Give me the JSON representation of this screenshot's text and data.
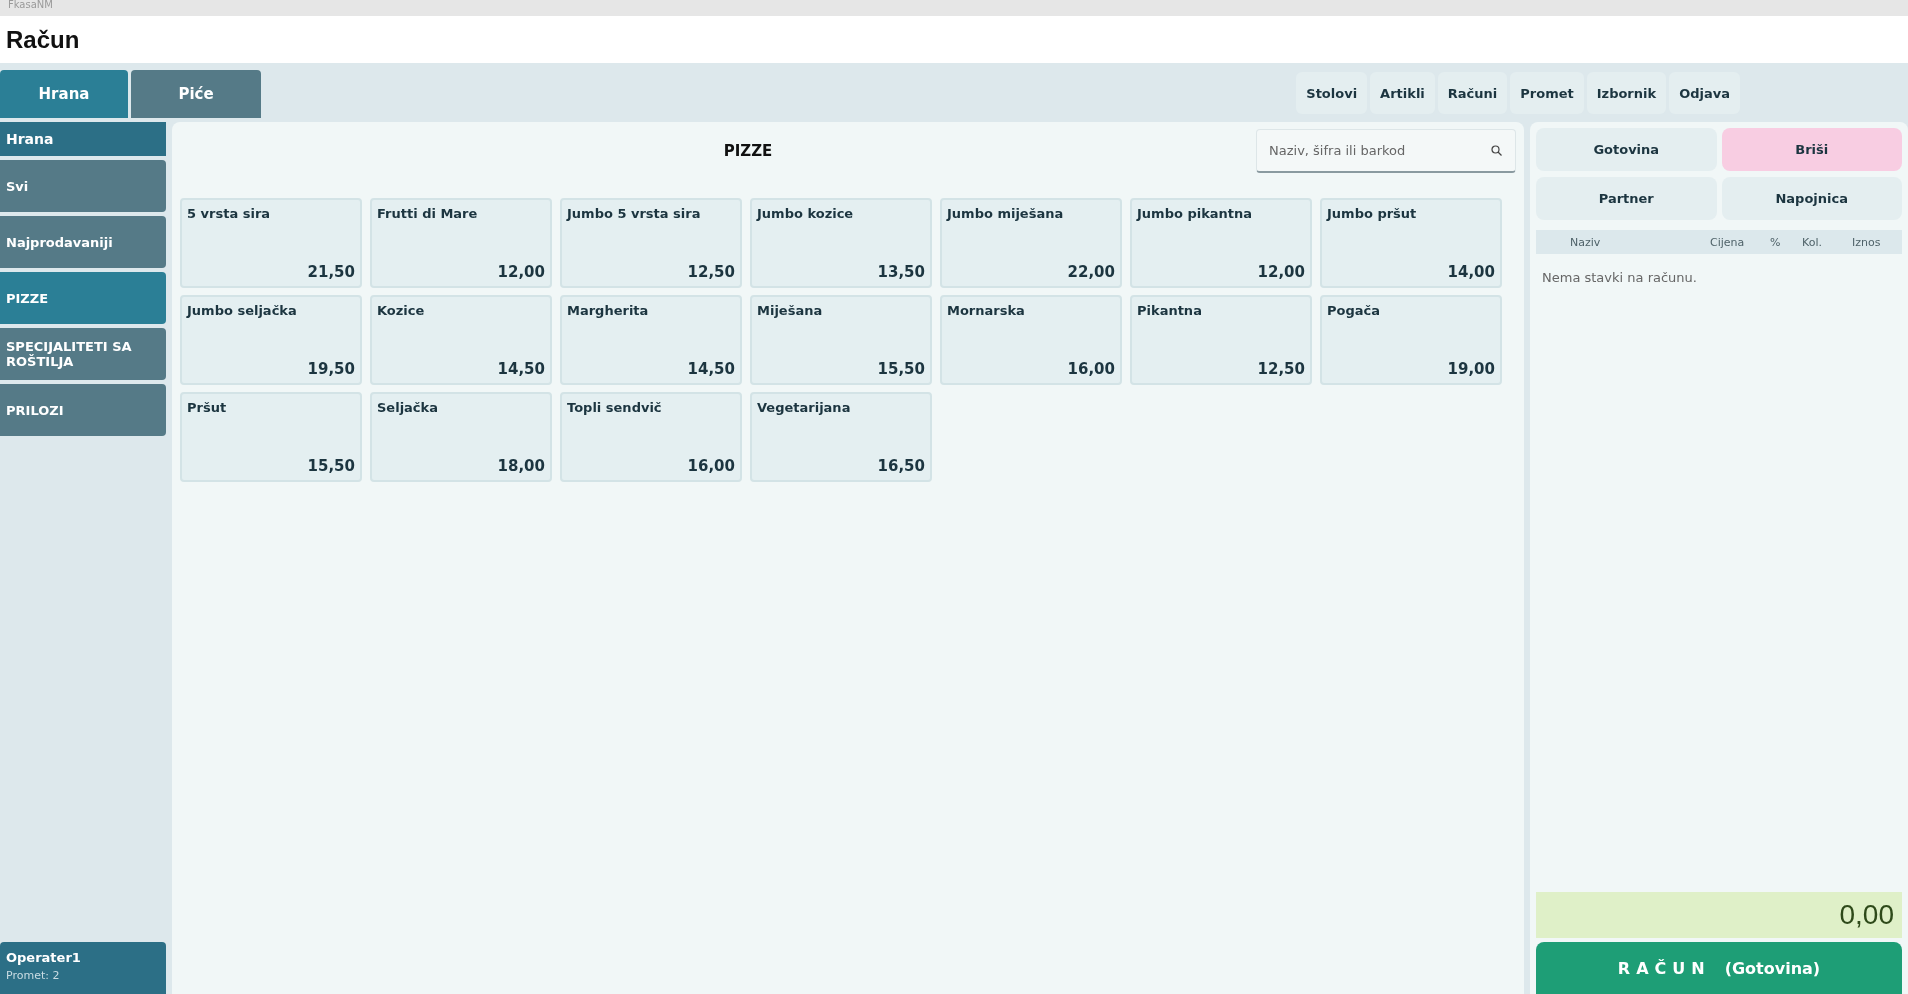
{
  "window": {
    "title": "FkasaNM"
  },
  "header": {
    "title": "Račun"
  },
  "group_tabs": [
    {
      "label": "Hrana",
      "selected": true
    },
    {
      "label": "Piće",
      "selected": false
    }
  ],
  "nav_buttons": [
    "Stolovi",
    "Artikli",
    "Računi",
    "Promet",
    "Izbornik",
    "Odjava"
  ],
  "sidebar": {
    "heading": "Hrana",
    "items": [
      {
        "label": "Svi",
        "selected": false
      },
      {
        "label": "Najprodavaniji",
        "selected": false
      },
      {
        "label": "PIZZE",
        "selected": true
      },
      {
        "label": "SPECIJALITETI SA ROŠTILJA",
        "selected": false
      },
      {
        "label": "PRILOZI",
        "selected": false
      }
    ],
    "operator": {
      "name": "Operater1",
      "info": "Promet: 2"
    }
  },
  "products": {
    "title": "PIZZE",
    "search": {
      "placeholder": "Naziv, šifra ili barkod"
    },
    "items": [
      {
        "name": "5 vrsta sira",
        "price": "21,50"
      },
      {
        "name": "Frutti di Mare",
        "price": "12,00"
      },
      {
        "name": "Jumbo 5 vrsta sira",
        "price": "12,50"
      },
      {
        "name": "Jumbo kozice",
        "price": "13,50"
      },
      {
        "name": "Jumbo miješana",
        "price": "22,00"
      },
      {
        "name": "Jumbo pikantna",
        "price": "12,00"
      },
      {
        "name": "Jumbo pršut",
        "price": "14,00"
      },
      {
        "name": "Jumbo seljačka",
        "price": "19,50"
      },
      {
        "name": "Kozice",
        "price": "14,50"
      },
      {
        "name": "Margherita",
        "price": "14,50"
      },
      {
        "name": "Miješana",
        "price": "15,50"
      },
      {
        "name": "Mornarska",
        "price": "16,00"
      },
      {
        "name": "Pikantna",
        "price": "12,50"
      },
      {
        "name": "Pogača",
        "price": "19,00"
      },
      {
        "name": "Pršut",
        "price": "15,50"
      },
      {
        "name": "Seljačka",
        "price": "18,00"
      },
      {
        "name": "Topli sendvič",
        "price": "16,00"
      },
      {
        "name": "Vegetarijana",
        "price": "16,50"
      }
    ]
  },
  "bill": {
    "actions": [
      {
        "label": "Gotovina",
        "kind": "normal"
      },
      {
        "label": "Briši",
        "kind": "danger"
      },
      {
        "label": "Partner",
        "kind": "normal"
      },
      {
        "label": "Napojnica",
        "kind": "normal"
      }
    ],
    "columns": [
      "Naziv",
      "Cijena",
      "%",
      "Kol.",
      "Iznos"
    ],
    "empty_text": "Nema stavki na računu.",
    "total": "0,00",
    "submit": {
      "label": "RAČUN",
      "payment": "(Gotovina)"
    }
  }
}
